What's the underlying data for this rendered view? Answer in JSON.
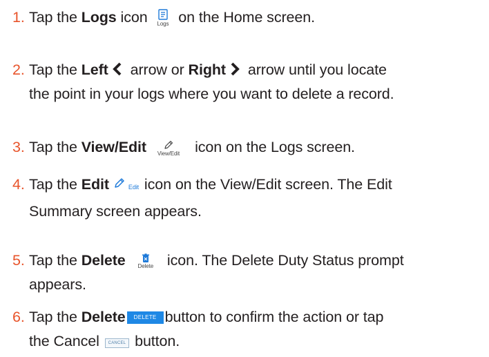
{
  "steps": [
    {
      "num": "1.",
      "pre": "Tap the ",
      "bold": "Logs",
      "mid": " icon",
      "icon_label": "Logs",
      "post": "on the Home screen."
    },
    {
      "num": "2.",
      "pre": "Tap the ",
      "bold1": "Left",
      "mid1": " arrow or ",
      "bold2": "Right",
      "mid2": " arrow until you locate",
      "line2": "the point in your logs where you want to delete a record."
    },
    {
      "num": "3.",
      "pre": "Tap the ",
      "bold": "View/Edit",
      "icon_label": "View/Edit",
      "post": "icon on the Logs screen."
    },
    {
      "num": "4.",
      "pre": "Tap the ",
      "bold": "Edit",
      "icon_label": "Edit",
      "post": "icon on the View/Edit screen. The Edit",
      "line2": "Summary screen appears."
    },
    {
      "num": "5.",
      "pre": "Tap the ",
      "bold": "Delete",
      "icon_label": "Delete",
      "post": "icon. The Delete Duty Status prompt",
      "line2": "appears."
    },
    {
      "num": "6.",
      "pre": "Tap the ",
      "bold": "Delete",
      "button_label": "DELETE",
      "post": "button to confirm the action or tap",
      "line2_pre": "the Cancel",
      "cancel_label": "CANCEL",
      "line2_post": "button."
    }
  ],
  "colors": {
    "step_number": "#e8542b",
    "text": "#231f20",
    "accent": "#1e88e5"
  },
  "icons": [
    "logs-icon",
    "left-arrow-icon",
    "right-arrow-icon",
    "view-edit-icon",
    "edit-pencil-icon",
    "delete-trash-icon"
  ]
}
